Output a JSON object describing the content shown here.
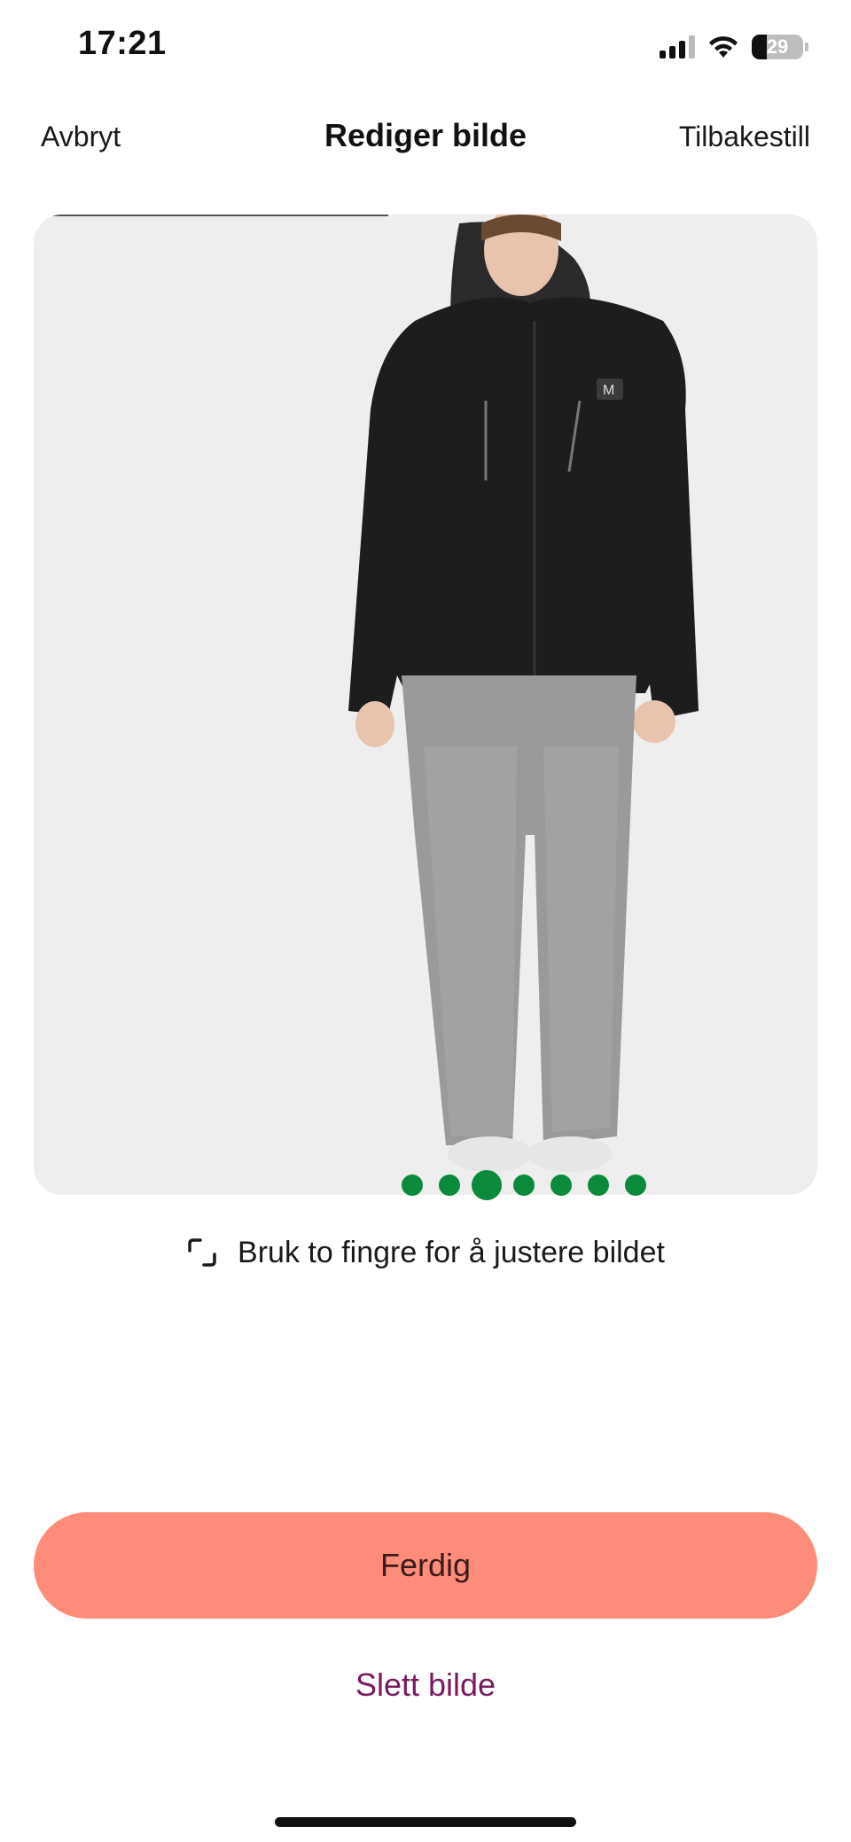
{
  "status_bar": {
    "time": "17:21",
    "battery_percent": "29",
    "icons": [
      "cellular-signal-icon",
      "wifi-icon",
      "battery-icon"
    ]
  },
  "nav": {
    "cancel_label": "Avbryt",
    "title": "Rediger bilde",
    "reset_label": "Tilbakestill"
  },
  "photo": {
    "content": "product-photo-woman-black-jacket-grey-jeans",
    "background_color": "#eeeeee"
  },
  "pagination": {
    "count": 7,
    "active_index": 2,
    "color": "#0a8a3a"
  },
  "hint": {
    "icon": "resize-corners-icon",
    "text": "Bruk to fingre for å justere bildet"
  },
  "actions": {
    "done_label": "Ferdig",
    "done_color": "#fd8d7a",
    "delete_label": "Slett bilde",
    "delete_color": "#7a1a5e"
  }
}
